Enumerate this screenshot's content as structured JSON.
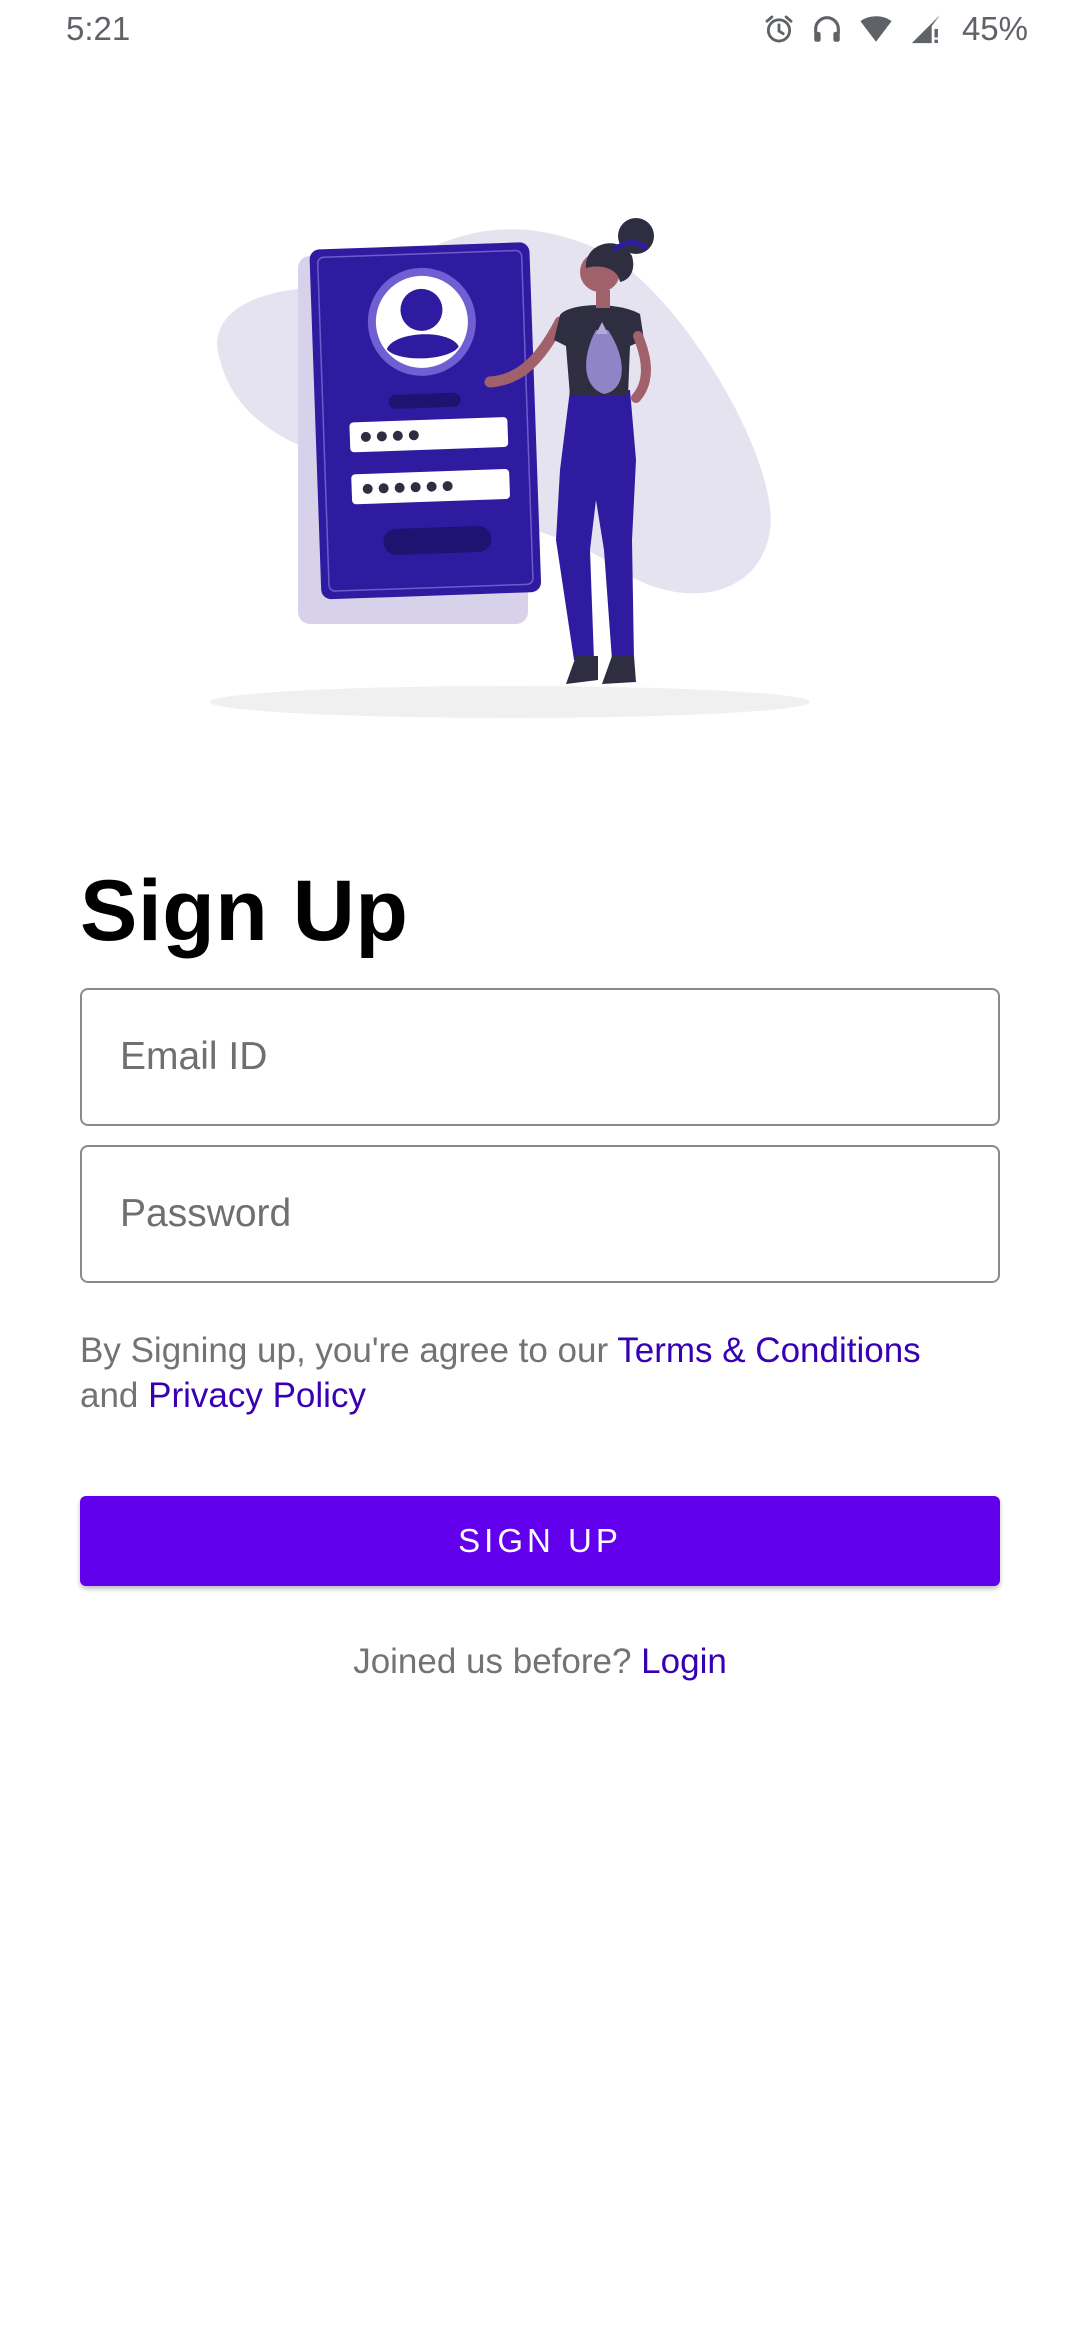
{
  "status_bar": {
    "time": "5:21",
    "battery": "45%",
    "icons": [
      "alarm-icon",
      "headphones-icon",
      "wifi-icon",
      "cell-signal-icon"
    ]
  },
  "illustration": {
    "name": "sign-up-illustration",
    "colors": {
      "primary": "#2f1ba0",
      "light": "#e6e3f1",
      "dark": "#2f2e41",
      "skin": "#a0616a"
    }
  },
  "page": {
    "title": "Sign Up"
  },
  "form": {
    "email_placeholder": "Email ID",
    "password_placeholder": "Password"
  },
  "terms": {
    "prefix": "By Signing up, you're agree to our ",
    "terms_link": "Terms & Conditions",
    "middle": " and ",
    "privacy_link": "Privacy Policy"
  },
  "signup_button": {
    "label": "SIGN UP"
  },
  "login": {
    "prompt": "Joined us before? ",
    "link": "Login"
  },
  "colors": {
    "accent": "#6200ee",
    "link": "#3700b3",
    "muted_text": "#737373"
  }
}
